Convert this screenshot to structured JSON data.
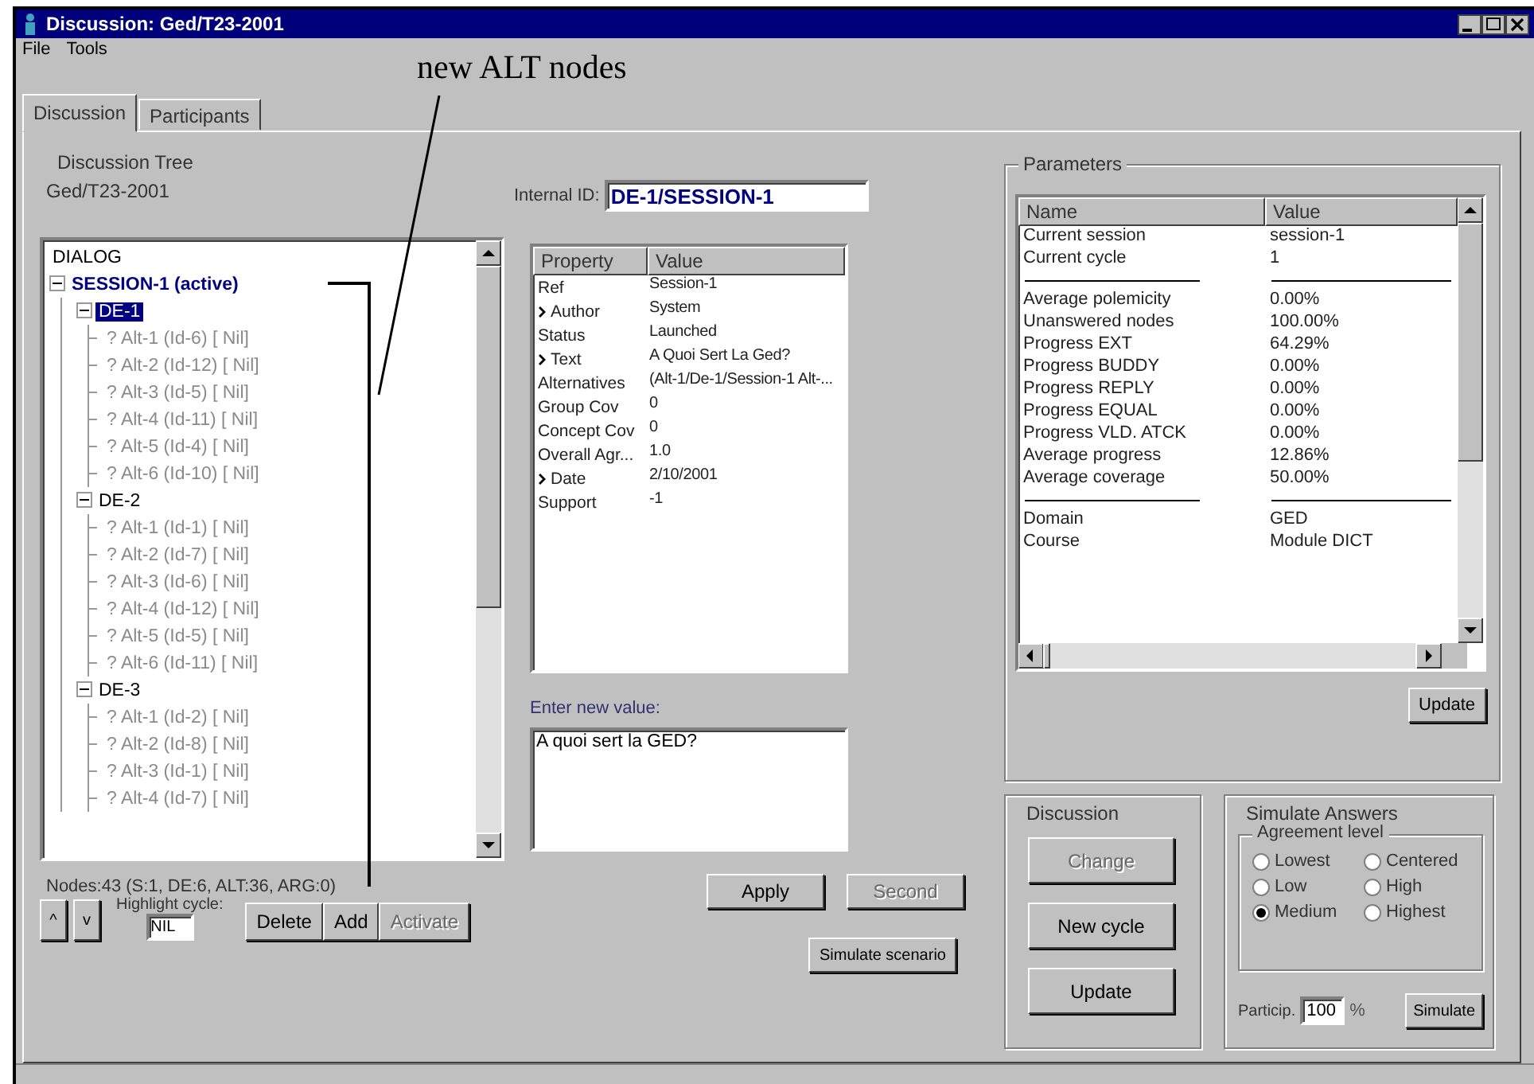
{
  "window": {
    "title": "Discussion: Ged/T23-2001"
  },
  "menu": [
    {
      "label": "File"
    },
    {
      "label": "Tools"
    }
  ],
  "tabs": [
    {
      "label": "Discussion",
      "selected": true
    },
    {
      "label": "Participants",
      "selected": false
    }
  ],
  "annotation": {
    "text": "new ALT nodes"
  },
  "tree_panel": {
    "title": "Discussion Tree",
    "name": "Ged/T23-2001",
    "tree": [
      {
        "label": "DIALOG",
        "kind": "root",
        "selected": false,
        "children": [
          {
            "label": "SESSION-1 (active)",
            "kind": "session",
            "selected": false,
            "expanded": true,
            "children": [
              {
                "label": "DE-1",
                "kind": "element",
                "selected": true,
                "expanded": true,
                "children": [
                  {
                    "label": "? Alt-1 (Id-6) [ Nil]",
                    "kind": "alt",
                    "selected": false
                  },
                  {
                    "label": "? Alt-2 (Id-12) [ Nil]",
                    "kind": "alt",
                    "selected": false
                  },
                  {
                    "label": "? Alt-3 (Id-5) [ Nil]",
                    "kind": "alt",
                    "selected": false
                  },
                  {
                    "label": "? Alt-4 (Id-11) [ Nil]",
                    "kind": "alt",
                    "selected": false
                  },
                  {
                    "label": "? Alt-5 (Id-4) [ Nil]",
                    "kind": "alt",
                    "selected": false
                  },
                  {
                    "label": "? Alt-6 (Id-10) [ Nil]",
                    "kind": "alt",
                    "selected": false
                  }
                ]
              },
              {
                "label": "DE-2",
                "kind": "element",
                "selected": false,
                "expanded": true,
                "children": [
                  {
                    "label": "? Alt-1 (Id-1) [ Nil]",
                    "kind": "alt",
                    "selected": false
                  },
                  {
                    "label": "? Alt-2 (Id-7) [ Nil]",
                    "kind": "alt",
                    "selected": false
                  },
                  {
                    "label": "? Alt-3 (Id-6) [ Nil]",
                    "kind": "alt",
                    "selected": false
                  },
                  {
                    "label": "? Alt-4 (Id-12) [ Nil]",
                    "kind": "alt",
                    "selected": false
                  },
                  {
                    "label": "? Alt-5 (Id-5) [ Nil]",
                    "kind": "alt",
                    "selected": false
                  },
                  {
                    "label": "? Alt-6 (Id-11) [ Nil]",
                    "kind": "alt",
                    "selected": false
                  }
                ]
              },
              {
                "label": "DE-3",
                "kind": "element",
                "selected": false,
                "expanded": true,
                "children": [
                  {
                    "label": "? Alt-1 (Id-2) [ Nil]",
                    "kind": "alt",
                    "selected": false
                  },
                  {
                    "label": "? Alt-2 (Id-8) [ Nil]",
                    "kind": "alt",
                    "selected": false
                  },
                  {
                    "label": "? Alt-3 (Id-1) [ Nil]",
                    "kind": "alt",
                    "selected": false
                  },
                  {
                    "label": "? Alt-4 (Id-7) [ Nil]",
                    "kind": "alt",
                    "selected": false
                  }
                ]
              }
            ]
          }
        ]
      }
    ],
    "node_count": "Nodes:43 (S:1, DE:6, ALT:36, ARG:0)",
    "highlight_label": "Highlight cycle:",
    "highlight_value": "NIL",
    "nav_buttons": [
      {
        "label": "^",
        "disabled": false
      },
      {
        "label": "v",
        "disabled": false
      }
    ],
    "buttons": [
      {
        "label": "Delete",
        "disabled": false
      },
      {
        "label": "Add",
        "disabled": false
      },
      {
        "label": "Activate",
        "disabled": true
      }
    ]
  },
  "details": {
    "id_label": "Internal ID:",
    "id_value": "DE-1/SESSION-1",
    "columns": [
      "Property",
      "Value"
    ],
    "rows": [
      {
        "property": "Ref",
        "value": "Session-1",
        "editable": false
      },
      {
        "property": "Author",
        "value": "System",
        "editable": true
      },
      {
        "property": "Status",
        "value": "Launched",
        "editable": false
      },
      {
        "property": "Text",
        "value": "A Quoi Sert La Ged?",
        "editable": true
      },
      {
        "property": "Alternatives",
        "value": "(Alt-1/De-1/Session-1 Alt-...",
        "editable": false
      },
      {
        "property": "Group Cov",
        "value": "0",
        "editable": false
      },
      {
        "property": "Concept Cov",
        "value": "0",
        "editable": false
      },
      {
        "property": "Overall Agr...",
        "value": "1.0",
        "editable": false
      },
      {
        "property": "Date",
        "value": "2/10/2001",
        "editable": true
      },
      {
        "property": "Support",
        "value": "-1",
        "editable": false
      }
    ],
    "new_value_label": "Enter new value:",
    "new_value": "A quoi sert la GED?",
    "buttons": [
      {
        "label": "Apply",
        "disabled": false
      },
      {
        "label": "Second",
        "disabled": true
      }
    ],
    "simulate_button": "Simulate scenario"
  },
  "parameters": {
    "title": "Parameters",
    "columns": [
      "Name",
      "Value"
    ],
    "rows": [
      {
        "kind": "row",
        "name": "Current session",
        "value": "session-1"
      },
      {
        "kind": "row",
        "name": "Current cycle",
        "value": "1"
      },
      {
        "kind": "separator"
      },
      {
        "kind": "row",
        "name": "Average polemicity",
        "value": "0.00%"
      },
      {
        "kind": "row",
        "name": "Unanswered nodes",
        "value": "100.00%"
      },
      {
        "kind": "row",
        "name": "Progress EXT",
        "value": "64.29%"
      },
      {
        "kind": "row",
        "name": "Progress BUDDY",
        "value": "0.00%"
      },
      {
        "kind": "row",
        "name": "Progress REPLY",
        "value": "0.00%"
      },
      {
        "kind": "row",
        "name": "Progress EQUAL",
        "value": "0.00%"
      },
      {
        "kind": "row",
        "name": "Progress VLD. ATCK",
        "value": "0.00%"
      },
      {
        "kind": "row",
        "name": "Average progress",
        "value": "12.86%"
      },
      {
        "kind": "row",
        "name": "Average coverage",
        "value": "50.00%"
      },
      {
        "kind": "separator"
      },
      {
        "kind": "row",
        "name": "Domain",
        "value": "GED"
      },
      {
        "kind": "row",
        "name": "Course",
        "value": "Module DICT"
      }
    ],
    "update_button": "Update"
  },
  "discussion_box": {
    "title": "Discussion",
    "buttons": [
      {
        "label": "Change",
        "disabled": true
      },
      {
        "label": "New cycle",
        "disabled": false
      },
      {
        "label": "Update",
        "disabled": false
      }
    ]
  },
  "simulate_box": {
    "title": "Simulate Answers",
    "group_title": "Agreement level",
    "options": [
      {
        "label": "Lowest",
        "selected": false
      },
      {
        "label": "Centered",
        "selected": false
      },
      {
        "label": "Low",
        "selected": false
      },
      {
        "label": "High",
        "selected": false
      },
      {
        "label": "Medium",
        "selected": true
      },
      {
        "label": "Highest",
        "selected": false
      }
    ],
    "particip_label": "Particip.",
    "particip_value": "100",
    "unit": "%",
    "simulate_button": "Simulate"
  }
}
